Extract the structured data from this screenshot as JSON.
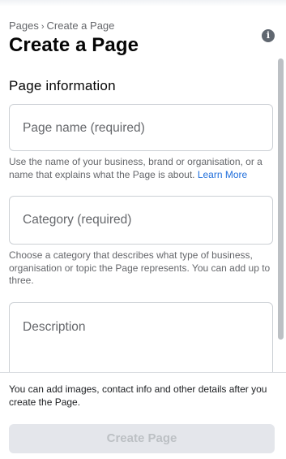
{
  "breadcrumb": {
    "parent": "Pages",
    "separator": "›",
    "current": "Create a Page"
  },
  "header": {
    "title": "Create a Page",
    "info_icon_glyph": "i"
  },
  "form": {
    "section_title": "Page information",
    "page_name": {
      "placeholder": "Page name (required)",
      "value": "",
      "helper": "Use the name of your business, brand or organisation, or a name that explains what the Page is about.",
      "helper_link": "Learn More"
    },
    "category": {
      "placeholder": "Category (required)",
      "value": "",
      "helper": "Choose a category that describes what type of business, organisation or topic the Page represents. You can add up to three."
    },
    "description": {
      "placeholder": "Description",
      "value": ""
    }
  },
  "footer": {
    "note": "You can add images, contact info and other details after you create the Page.",
    "create_button_label": "Create Page"
  },
  "colors": {
    "link": "#216fdb",
    "muted_text": "#65676b",
    "disabled_button_bg": "#e4e6eb",
    "disabled_button_text": "#bcc0c4",
    "field_border": "#ccd0d5"
  },
  "icons": {
    "info": "info-icon"
  }
}
